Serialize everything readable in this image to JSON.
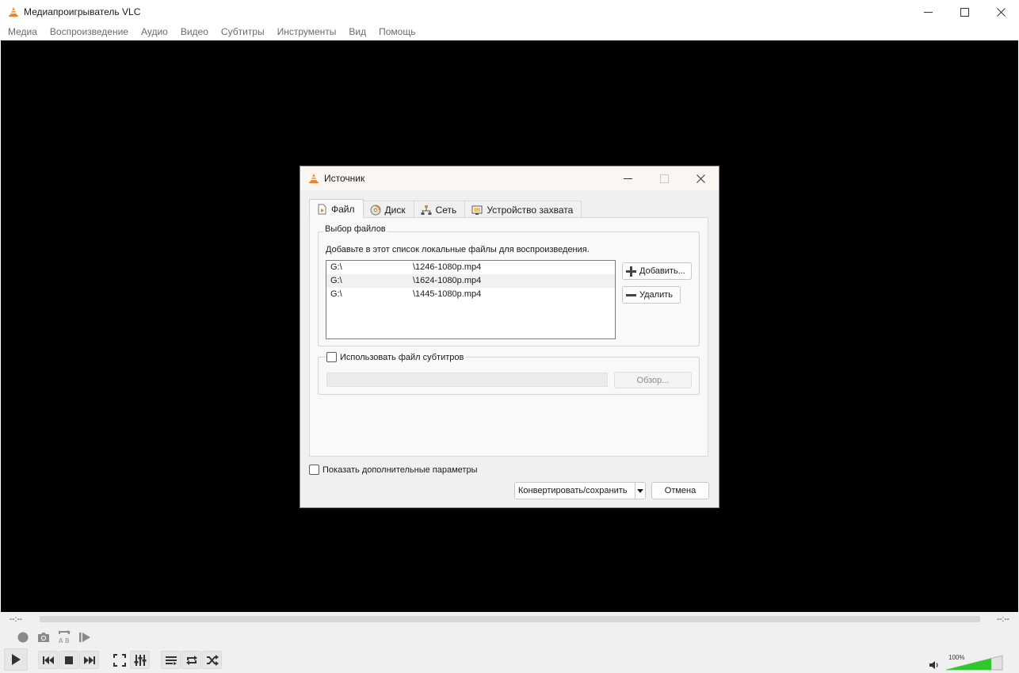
{
  "window": {
    "title": "Медиапроигрыватель VLC",
    "controls": [
      "minimize-icon",
      "maximize-icon",
      "close-icon"
    ]
  },
  "menubar": {
    "items": [
      "Медиа",
      "Воспроизведение",
      "Аудио",
      "Видео",
      "Субтитры",
      "Инструменты",
      "Вид",
      "Помощь"
    ]
  },
  "player": {
    "time_elapsed": "--:--",
    "time_total": "--:--",
    "seek_progress": 0,
    "volume_label": "100%",
    "volume_level": 1.0,
    "icons": {
      "row1": [
        "record-icon",
        "snapshot-icon",
        "ab-loop-icon",
        "frame-step-icon"
      ],
      "row2": [
        "play-icon",
        "previous-icon",
        "stop-icon",
        "next-icon",
        "fullscreen-icon",
        "extended-settings-icon",
        "playlist-icon",
        "loop-icon",
        "shuffle-icon"
      ],
      "volume": "speaker-icon"
    },
    "colors": {
      "volume_fill": "#2ec82e",
      "video_bg": "#000000"
    }
  },
  "dialog": {
    "title": "Источник",
    "tabs": [
      {
        "label": "Файл",
        "icon": "file-icon",
        "active": true
      },
      {
        "label": "Диск",
        "icon": "disc-icon",
        "active": false
      },
      {
        "label": "Сеть",
        "icon": "network-icon",
        "active": false
      },
      {
        "label": "Устройство захвата",
        "icon": "capture-device-icon",
        "active": false
      }
    ],
    "file_selection": {
      "group_label": "Выбор файлов",
      "description": "Добавьте в этот список локальные файлы для воспроизведения.",
      "files": [
        {
          "drive": "G:\\",
          "name": "\\1246-1080p.mp4"
        },
        {
          "drive": "G:\\",
          "name": "\\1624-1080p.mp4"
        },
        {
          "drive": "G:\\",
          "name": "\\1445-1080p.mp4"
        }
      ],
      "add_button": "Добавить...",
      "remove_button": "Удалить"
    },
    "subtitles": {
      "checkbox_label": "Использовать файл субтитров",
      "checked": false,
      "path_value": "",
      "browse_button": "Обзор..."
    },
    "more_options": {
      "label": "Показать дополнительные параметры",
      "checked": false
    },
    "convert_button": "Конвертировать/сохранить",
    "cancel_button": "Отмена"
  }
}
